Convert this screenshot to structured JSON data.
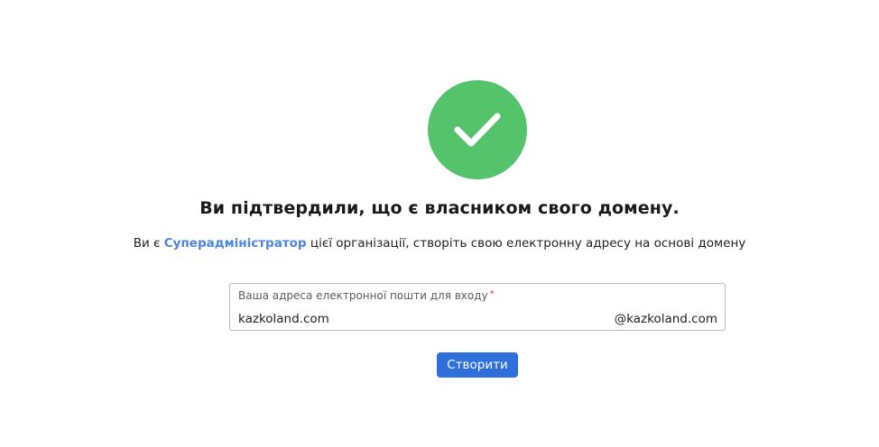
{
  "status": {
    "icon": "checkmark-icon",
    "color": "#55c26c"
  },
  "heading": "Ви підтвердили, що є власником свого домену.",
  "subtext": {
    "prefix": "Ви є ",
    "role": "Суперадміністратор",
    "suffix": " цієї організації, створіть свою електронну адресу на основі домену"
  },
  "email_field": {
    "label": "Ваша адреса електронної пошти для входу",
    "required_mark": "*",
    "value": "kazkoland.com",
    "domain_suffix": "@kazkoland.com"
  },
  "actions": {
    "create_label": "Створити",
    "accent_color": "#2f6fdc"
  }
}
